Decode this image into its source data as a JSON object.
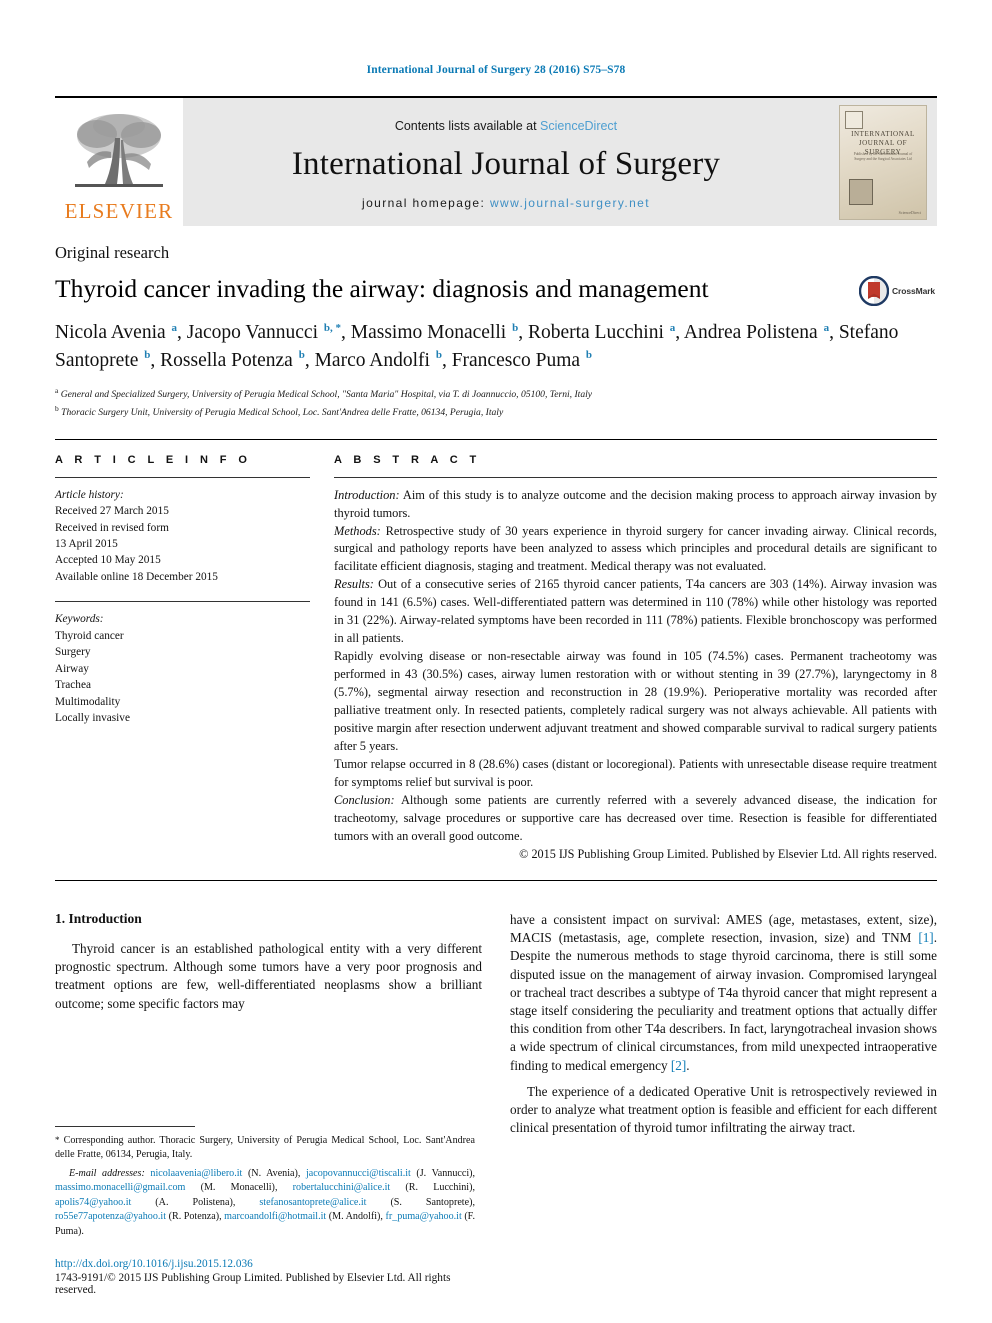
{
  "running_head": "International Journal of Surgery 28 (2016) S75–S78",
  "masthead": {
    "contents_prefix": "Contents lists available at ",
    "sciencedirect": "ScienceDirect",
    "journal_title": "International Journal of Surgery",
    "homepage_prefix": "journal homepage: ",
    "homepage_url": "www.journal-surgery.net",
    "publisher_name": "ELSEVIER",
    "cover": {
      "title_line1": "INTERNATIONAL",
      "title_line2": "JOURNAL OF SURGERY",
      "subtitle": "Published by the International Journal of Surgery and the Surgical Associates Ltd",
      "footer": "ScienceDirect"
    },
    "colors": {
      "link_blue": "#4e9fd1",
      "elsevier_orange": "#E87B1E",
      "band_grey": "#e8e8e8"
    }
  },
  "article": {
    "section_label": "Original research",
    "title": "Thyroid cancer invading the airway: diagnosis and management",
    "crossmark_label": "CrossMark",
    "authors_html": "Nicola Avenia <sup>a</sup>, Jacopo Vannucci <sup>b, *</sup>, Massimo Monacelli <sup>b</sup>, Roberta Lucchini <sup>a</sup>, Andrea Polistena <sup>a</sup>, Stefano Santoprete <sup>b</sup>, Rossella Potenza <sup>b</sup>, Marco Andolfi <sup>b</sup>, Francesco Puma <sup>b</sup>",
    "affiliations": [
      "General and Specialized Surgery, University of Perugia Medical School, \"Santa Maria\" Hospital, via T. di Joannuccio, 05100, Terni, Italy",
      "Thoracic Surgery Unit, University of Perugia Medical School, Loc. Sant'Andrea delle Fratte, 06134, Perugia, Italy"
    ],
    "affiliation_markers": [
      "a",
      "b"
    ]
  },
  "info": {
    "heading": "A R T I C L E   I N F O",
    "history_label": "Article history:",
    "history": [
      "Received 27 March 2015",
      "Received in revised form",
      "13 April 2015",
      "Accepted 10 May 2015",
      "Available online 18 December 2015"
    ],
    "keywords_label": "Keywords:",
    "keywords": [
      "Thyroid cancer",
      "Surgery",
      "Airway",
      "Trachea",
      "Multimodality",
      "Locally invasive"
    ]
  },
  "abstract": {
    "heading": "A B S T R A C T",
    "introduction_label": "Introduction:",
    "introduction_text": " Aim of this study is to analyze outcome and the decision making process to approach airway invasion by thyroid tumors.",
    "methods_label": "Methods:",
    "methods_text": " Retrospective study of 30 years experience in thyroid surgery for cancer invading airway. Clinical records, surgical and pathology reports have been analyzed to assess which principles and procedural details are significant to facilitate efficient diagnosis, staging and treatment. Medical therapy was not evaluated.",
    "results_label": "Results:",
    "results_text": " Out of a consecutive series of 2165 thyroid cancer patients, T4a cancers are 303 (14%). Airway invasion was found in 141 (6.5%) cases. Well-differentiated pattern was determined in 110 (78%) while other histology was reported in 31 (22%). Airway-related symptoms have been recorded in 111 (78%) patients. Flexible bronchoscopy was performed in all patients.",
    "results_text2": "Rapidly evolving disease or non-resectable airway was found in 105 (74.5%) cases. Permanent tracheotomy was performed in 43 (30.5%) cases, airway lumen restoration with or without stenting in 39 (27.7%), laryngectomy in 8 (5.7%), segmental airway resection and reconstruction in 28 (19.9%). Perioperative mortality was recorded after palliative treatment only. In resected patients, completely radical surgery was not always achievable. All patients with positive margin after resection underwent adjuvant treatment and showed comparable survival to radical surgery patients after 5 years.",
    "results_text3": "Tumor relapse occurred in 8 (28.6%) cases (distant or locoregional). Patients with unresectable disease require treatment for symptoms relief but survival is poor.",
    "conclusion_label": "Conclusion:",
    "conclusion_text": " Although some patients are currently referred with a severely advanced disease, the indication for tracheotomy, salvage procedures or supportive care has decreased over time. Resection is feasible for differentiated tumors with an overall good outcome.",
    "copyright": "© 2015 IJS Publishing Group Limited. Published by Elsevier Ltd. All rights reserved."
  },
  "body": {
    "intro_heading": "1. Introduction",
    "left_para1": "Thyroid cancer is an established pathological entity with a very different prognostic spectrum. Although some tumors have a very poor prognosis and treatment options are few, well-differentiated neoplasms show a brilliant outcome; some specific factors may",
    "right_para1_a": "have a consistent impact on survival: AMES (age, metastases, extent, size), MACIS (metastasis, age, complete resection, invasion, size) and TNM ",
    "right_ref1": "[1]",
    "right_para1_b": ". Despite the numerous methods to stage thyroid carcinoma, there is still some disputed issue on the management of airway invasion. Compromised laryngeal or tracheal tract describes a subtype of T4a thyroid cancer that might represent a stage itself considering the peculiarity and treatment options that actually differ this condition from other T4a describers. In fact, laryngotracheal invasion shows a wide spectrum of clinical circumstances, from mild unexpected intraoperative finding to medical emergency ",
    "right_ref2": "[2]",
    "right_para1_c": ".",
    "right_para2": "The experience of a dedicated Operative Unit is retrospectively reviewed in order to analyze what treatment option is feasible and efficient for each different clinical presentation of thyroid tumor infiltrating the airway tract."
  },
  "footnotes": {
    "corresponding_marker": "*",
    "corresponding_text": " Corresponding author. Thoracic Surgery, University of Perugia Medical School, Loc. Sant'Andrea delle Fratte, 06134, Perugia, Italy.",
    "email_label": "E-mail addresses:",
    "emails": [
      {
        "address": "nicolaavenia@libero.it",
        "owner": "(N. Avenia)"
      },
      {
        "address": "jacopovannucci@tiscali.it",
        "owner": "(J. Vannucci)"
      },
      {
        "address": "massimo.monacelli@gmail.com",
        "owner": "(M. Monacelli)"
      },
      {
        "address": "robertalucchini@alice.it",
        "owner": "(R. Lucchini)"
      },
      {
        "address": "apolis74@yahoo.it",
        "owner": "(A. Polistena)"
      },
      {
        "address": "stefanosantoprete@alice.it",
        "owner": "(S. Santoprete)"
      },
      {
        "address": "ro55e77apotenza@yahoo.it",
        "owner": "(R. Potenza)"
      },
      {
        "address": "marcoandolfi@hotmail.it",
        "owner": "(M. Andolfi)"
      },
      {
        "address": "fr_puma@yahoo.it",
        "owner": "(F. Puma)"
      }
    ],
    "doi": "http://dx.doi.org/10.1016/j.ijsu.2015.12.036",
    "issn_line": "1743-9191/© 2015 IJS Publishing Group Limited. Published by Elsevier Ltd. All rights reserved."
  }
}
